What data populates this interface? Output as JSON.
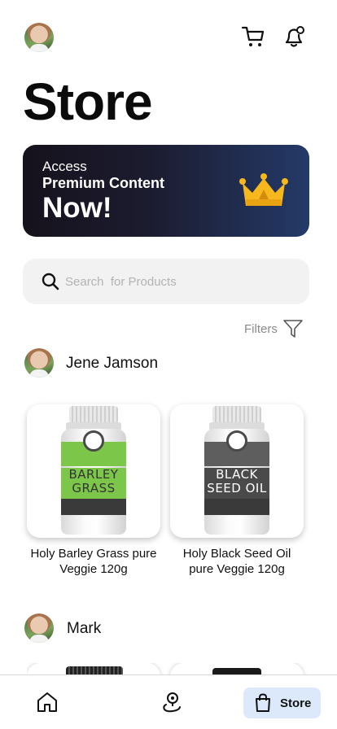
{
  "header": {
    "icons": [
      "user-avatar",
      "cart-icon",
      "bell-icon"
    ]
  },
  "page": {
    "title": "Store"
  },
  "promo": {
    "line1": "Access",
    "line2": "Premium Content",
    "line3": "Now!",
    "icon": "crown-icon",
    "gradient": [
      "#16121c",
      "#243a68"
    ],
    "crown_color": "#f6b81d"
  },
  "search": {
    "placeholder": "Search  for Products",
    "value": ""
  },
  "filters": {
    "label": "Filters"
  },
  "sellers": [
    {
      "name": "Jene Jamson",
      "products": [
        {
          "name": "Holy Barley Grass pure Veggie 120g",
          "label_color": "#7cc74a",
          "label_text": [
            "BARLEY",
            "GRASS"
          ]
        },
        {
          "name": "Holy Black Seed Oil pure Veggie 120g",
          "label_color": "#5e5e5e",
          "label_text": [
            "BLACK",
            "SEED OIL"
          ]
        }
      ]
    },
    {
      "name": "Mark",
      "products": []
    }
  ],
  "bottom_nav": {
    "items": [
      {
        "icon": "home-icon"
      },
      {
        "icon": "map-pin-icon"
      },
      {
        "icon": "shopping-bag-icon",
        "label": "Store",
        "active": true
      }
    ],
    "active_color": "#dbe9fb"
  }
}
